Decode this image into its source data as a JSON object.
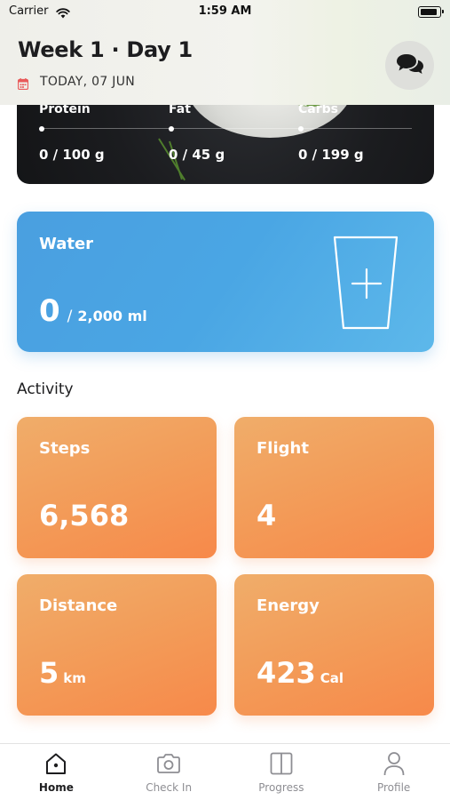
{
  "status_bar": {
    "carrier": "Carrier",
    "time": "1:59 AM"
  },
  "header": {
    "title": "Week 1 · Day 1",
    "date": "TODAY, 07 JUN"
  },
  "nutrition": {
    "macros": [
      {
        "label": "Protein",
        "current": "0",
        "goal": "100 g",
        "display": "0 / 100 g"
      },
      {
        "label": "Fat",
        "current": "0",
        "goal": "45 g",
        "display": "0 / 45 g"
      },
      {
        "label": "Carbs",
        "current": "0",
        "goal": "199 g",
        "display": "0 / 199 g"
      }
    ]
  },
  "water": {
    "title": "Water",
    "current": "0",
    "separator": "/",
    "goal": "2,000 ml"
  },
  "activity": {
    "title": "Activity",
    "tiles": [
      {
        "label": "Steps",
        "value": "6,568",
        "unit": ""
      },
      {
        "label": "Flight",
        "value": "4",
        "unit": ""
      },
      {
        "label": "Distance",
        "value": "5",
        "unit": "km"
      },
      {
        "label": "Energy",
        "value": "423",
        "unit": "Cal"
      }
    ]
  },
  "tabs": [
    {
      "label": "Home",
      "icon": "home-icon",
      "active": true
    },
    {
      "label": "Check In",
      "icon": "camera-icon",
      "active": false
    },
    {
      "label": "Progress",
      "icon": "split-view-icon",
      "active": false
    },
    {
      "label": "Profile",
      "icon": "person-icon",
      "active": false
    }
  ],
  "colors": {
    "water_card": "#4aa6e4",
    "activity_tile": "#f39a57",
    "calendar_icon": "#e85a5a"
  }
}
